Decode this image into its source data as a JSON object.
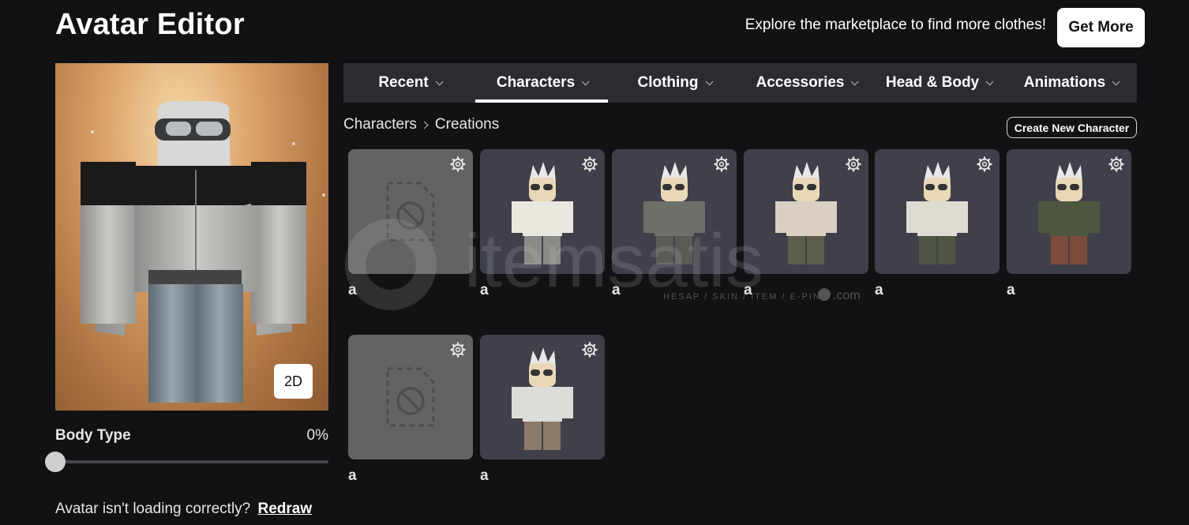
{
  "header": {
    "title": "Avatar Editor",
    "promo": "Explore the marketplace to find more clothes!",
    "get_more_label": "Get More"
  },
  "preview": {
    "mode_button": "2D"
  },
  "body_type": {
    "label": "Body Type",
    "value_text": "0%",
    "value": 0
  },
  "footer": {
    "question": "Avatar isn't loading correctly?",
    "redraw_label": "Redraw"
  },
  "tabs": [
    {
      "label": "Recent",
      "active": false
    },
    {
      "label": "Characters",
      "active": true
    },
    {
      "label": "Clothing",
      "active": false
    },
    {
      "label": "Accessories",
      "active": false
    },
    {
      "label": "Head & Body",
      "active": false
    },
    {
      "label": "Animations",
      "active": false
    }
  ],
  "breadcrumb": {
    "root": "Characters",
    "current": "Creations"
  },
  "create_button_label": "Create New Character",
  "characters": [
    {
      "name": "a",
      "thumbnail": "unavailable",
      "shirt": "",
      "pants": ""
    },
    {
      "name": "a",
      "thumbnail": "avatar",
      "shirt": "#e9e7df",
      "pants": "#8a8a86"
    },
    {
      "name": "a",
      "thumbnail": "avatar",
      "shirt": "#6d6f69",
      "pants": "#5a5b57"
    },
    {
      "name": "a",
      "thumbnail": "avatar",
      "shirt": "#d9cfc3",
      "pants": "#5d5e49"
    },
    {
      "name": "a",
      "thumbnail": "avatar",
      "shirt": "#dedbd2",
      "pants": "#4f5443"
    },
    {
      "name": "a",
      "thumbnail": "avatar",
      "shirt": "#4f5640",
      "pants": "#7d4b3b"
    },
    {
      "name": "a",
      "thumbnail": "unavailable",
      "shirt": "",
      "pants": ""
    },
    {
      "name": "a",
      "thumbnail": "avatar",
      "shirt": "#dcdcd8",
      "pants": "#8b7a67"
    }
  ],
  "watermark": {
    "text": "itemsatis",
    "tagline": "HESAP / SKIN / ITEM / E-PIN",
    "suffix": ".com"
  },
  "colors": {
    "background": "#121215",
    "tabbar": "#2b2c31",
    "card": "#3f4049",
    "card_empty": "#636366"
  }
}
